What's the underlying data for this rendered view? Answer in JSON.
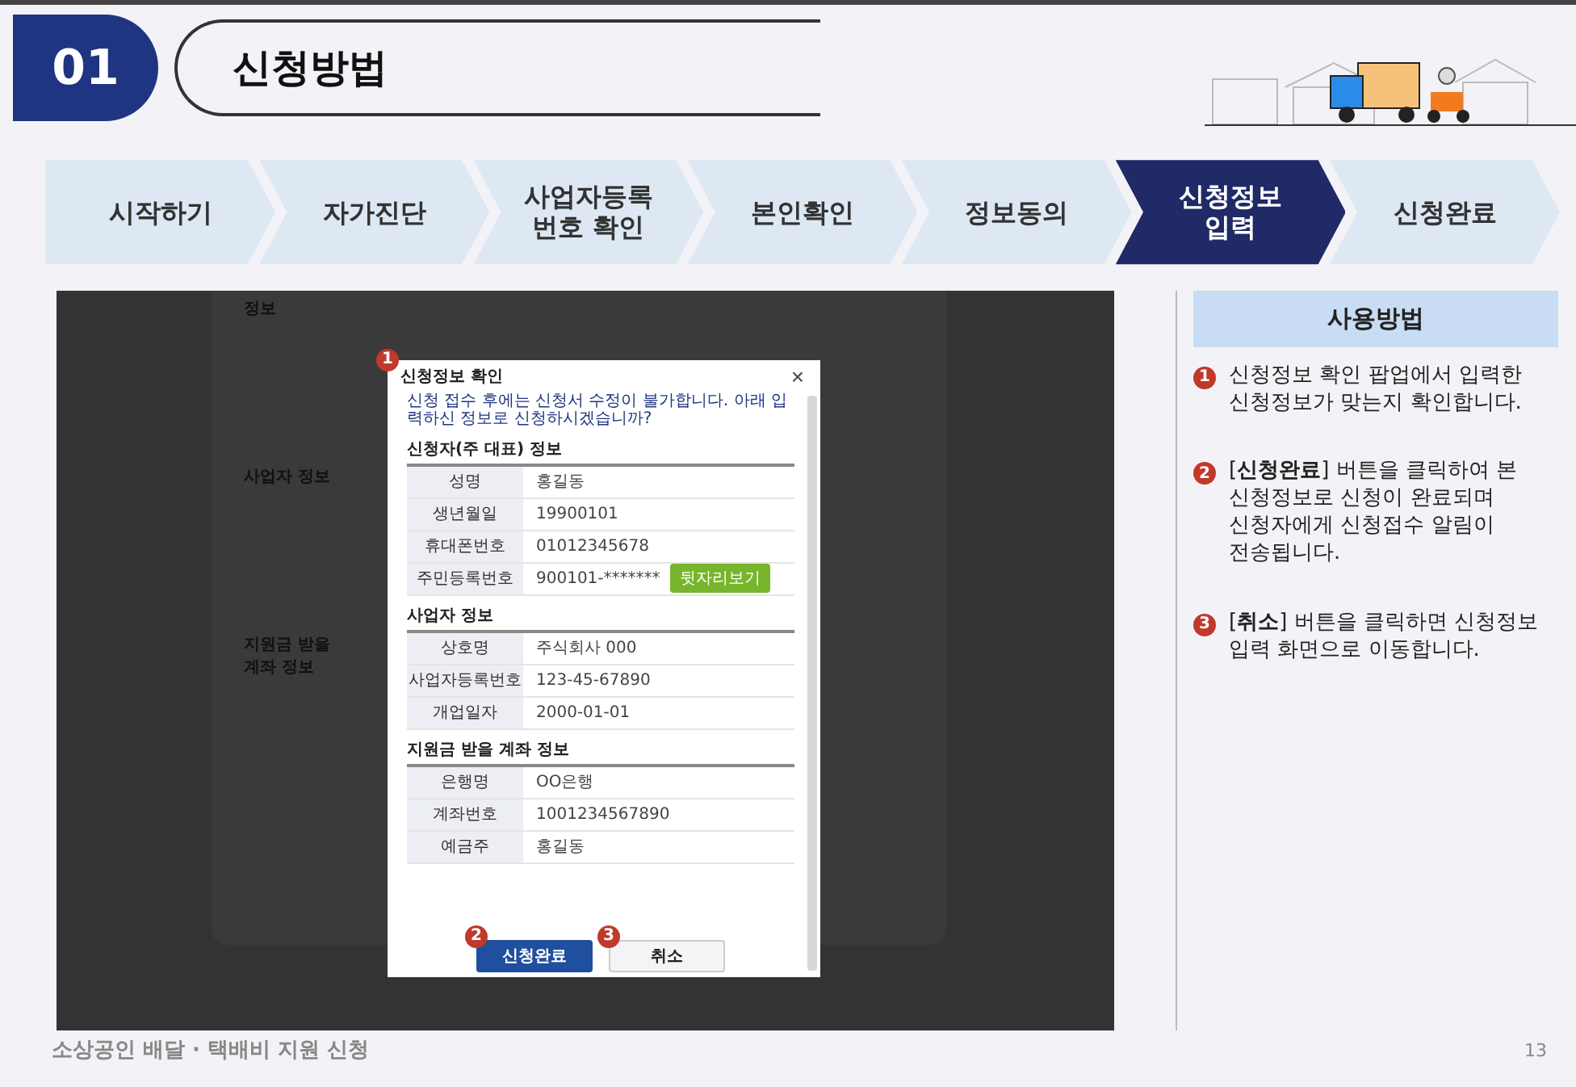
{
  "header": {
    "number": "01",
    "title": "신청방법"
  },
  "steps": [
    {
      "label": "시작하기",
      "selected": false
    },
    {
      "label": "자가진단",
      "selected": false
    },
    {
      "label": "사업자등록\n번호 확인",
      "selected": false
    },
    {
      "label": "본인확인",
      "selected": false
    },
    {
      "label": "정보동의",
      "selected": false
    },
    {
      "label": "신청정보\n입력",
      "selected": true
    },
    {
      "label": "신청완료",
      "selected": false
    }
  ],
  "screenshot": {
    "form_labels": [
      "정보",
      "사업자 정보",
      "지원금 받을\n계좌 정보"
    ],
    "popup": {
      "badge": "1",
      "title": "신청정보 확인",
      "close": "×",
      "notice": "신청 접수 후에는 신청서 수정이 불가합니다. 아래 입력하신 정보로 신청하시겠습니까?",
      "sections": [
        {
          "heading": "신청자(주 대표) 정보",
          "rows": [
            {
              "label": "성명",
              "value": "홍길동"
            },
            {
              "label": "생년월일",
              "value": "19900101"
            },
            {
              "label": "휴대폰번호",
              "value": "01012345678"
            },
            {
              "label": "주민등록번호",
              "value": "900101-*******",
              "action": "뒷자리보기"
            }
          ]
        },
        {
          "heading": "사업자 정보",
          "rows": [
            {
              "label": "상호명",
              "value": "주식회사 000"
            },
            {
              "label": "사업자등록번호",
              "value": "123-45-67890"
            },
            {
              "label": "개업일자",
              "value": "2000-01-01"
            }
          ]
        },
        {
          "heading": "지원금 받을 계좌 정보",
          "rows": [
            {
              "label": "은행명",
              "value": "OO은행"
            },
            {
              "label": "계좌번호",
              "value": "1001234567890"
            },
            {
              "label": "예금주",
              "value": "홍길동"
            }
          ]
        }
      ],
      "buttons": [
        {
          "label": "신청완료",
          "badge": "2",
          "kind": "primary"
        },
        {
          "label": "취소",
          "badge": "3",
          "kind": "secondary"
        }
      ]
    }
  },
  "guide": {
    "title": "사용방법",
    "items": [
      {
        "badge": "1",
        "text": "신청정보 확인 팝업에서 입력한 신청정보가 맞는지 확인합니다."
      },
      {
        "badge": "2",
        "text": "[**신청완료**] 버튼을 클릭하여 본 신청정보로 신청이 완료되며 신청자에게 신청접수 알림이 전송됩니다."
      },
      {
        "badge": "3",
        "text": "[**취소**] 버튼을 클릭하면 신청정보 입력 화면으로 이동합니다."
      }
    ]
  },
  "footer": {
    "title": "소상공인 배달 · 택배비 지원 신청",
    "page": "13"
  }
}
